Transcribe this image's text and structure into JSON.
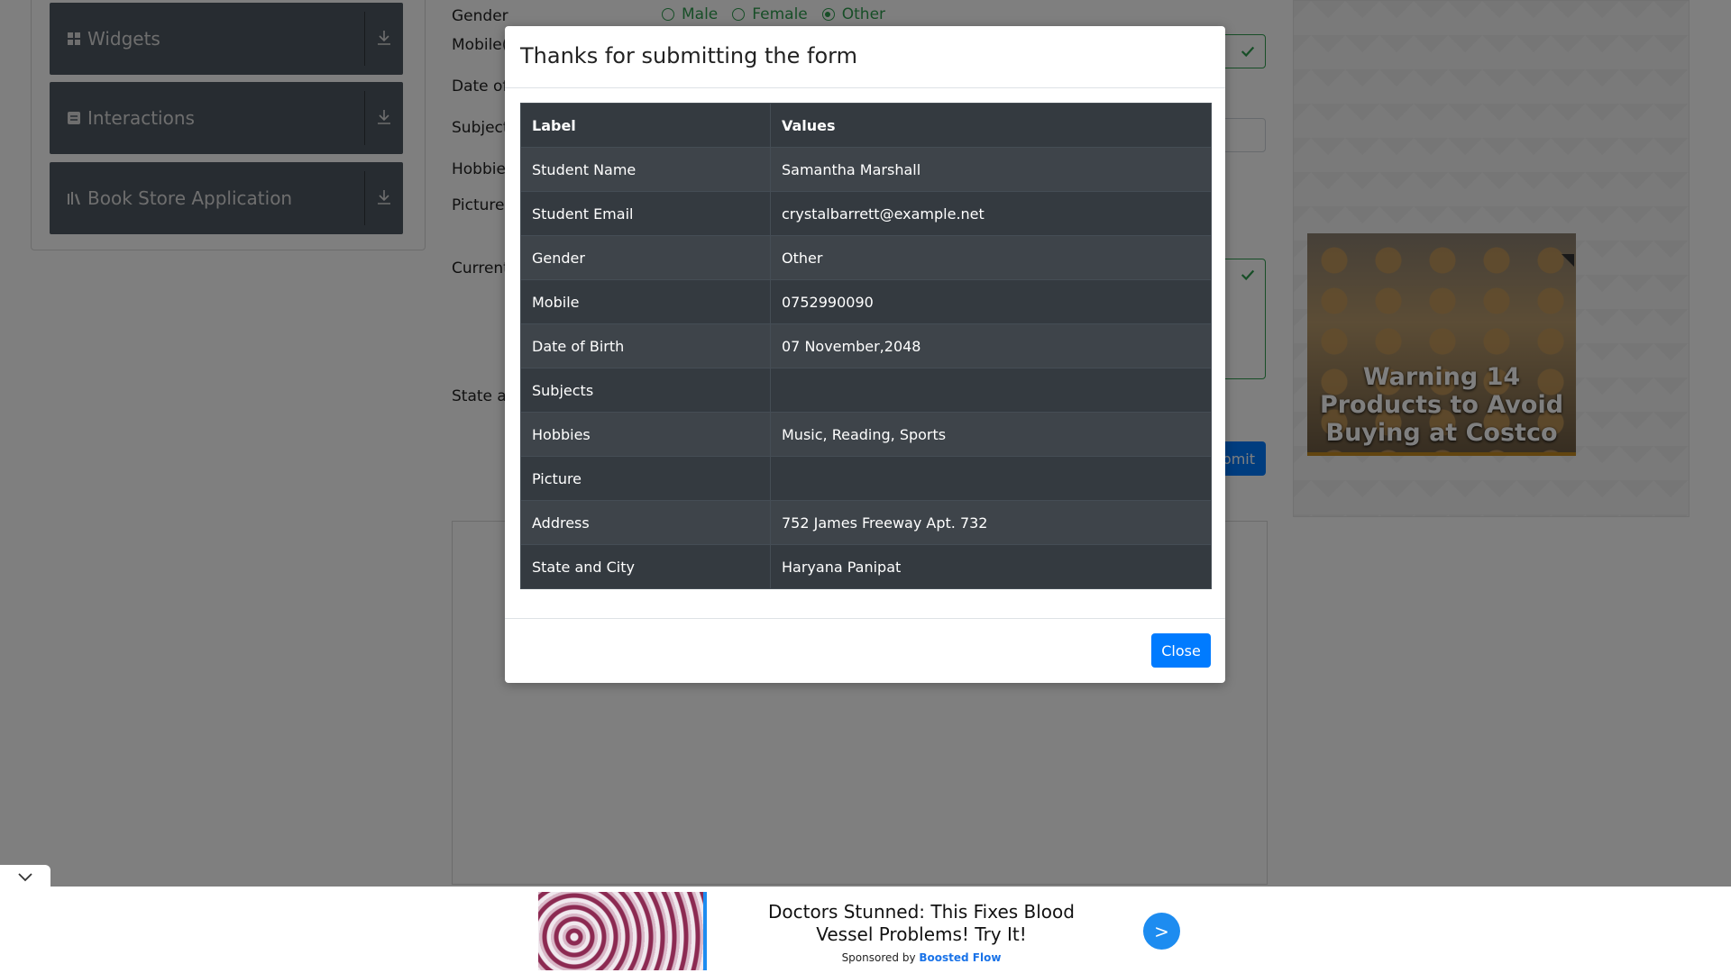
{
  "sidebar": {
    "groups": [
      {
        "label": "Widgets"
      },
      {
        "label": "Interactions"
      },
      {
        "label": "Book Store Application"
      }
    ]
  },
  "form": {
    "labels": {
      "gender": "Gender",
      "mobile": "Mobile(",
      "dob": "Date of",
      "subjects": "Subjects",
      "hobbies": "Hobbies",
      "picture": "Picture",
      "address": "Current",
      "state": "State an"
    },
    "gender_options": [
      "Male",
      "Female",
      "Other"
    ],
    "submit_label": "bmit"
  },
  "ad_right": {
    "caption": "Warning 14 Products to Avoid Buying at Costco"
  },
  "modal": {
    "title": "Thanks for submitting the form",
    "columns": [
      "Label",
      "Values"
    ],
    "rows": [
      {
        "label": "Student Name",
        "value": "Samantha Marshall"
      },
      {
        "label": "Student Email",
        "value": "crystalbarrett@example.net"
      },
      {
        "label": "Gender",
        "value": "Other"
      },
      {
        "label": "Mobile",
        "value": "0752990090"
      },
      {
        "label": "Date of Birth",
        "value": "07 November,2048"
      },
      {
        "label": "Subjects",
        "value": ""
      },
      {
        "label": "Hobbies",
        "value": "Music, Reading, Sports"
      },
      {
        "label": "Picture",
        "value": ""
      },
      {
        "label": "Address",
        "value": "752 James Freeway Apt. 732"
      },
      {
        "label": "State and City",
        "value": "Haryana Panipat"
      }
    ],
    "close_label": "Close"
  },
  "bottom_ad": {
    "headline": "Doctors Stunned: This Fixes Blood Vessel Problems! Try It!",
    "sponsored_prefix": "Sponsored by",
    "sponsor": "Boosted Flow",
    "go_label": ">"
  },
  "colors": {
    "primary": "#007bff",
    "valid_green": "#2e9d4f",
    "table_dark": "#343a40"
  }
}
